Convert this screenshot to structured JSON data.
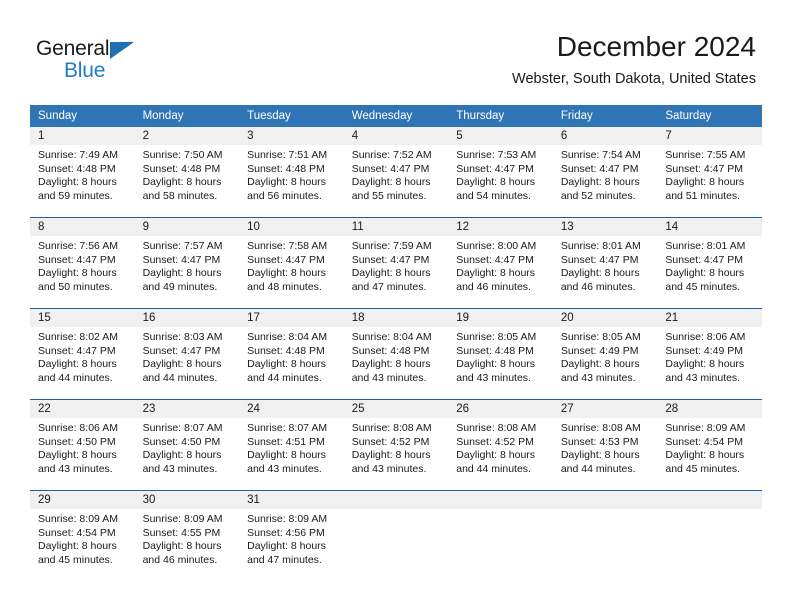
{
  "brand": {
    "name_part1": "General",
    "name_part2": "Blue",
    "accent_color": "#1f7ec4",
    "triangle_color": "#1f6fb5"
  },
  "header": {
    "title": "December 2024",
    "subtitle": "Webster, South Dakota, United States"
  },
  "calendar": {
    "header_bg": "#2f75b5",
    "daynum_bg": "#f0f0f0",
    "weekday_headers": [
      "Sunday",
      "Monday",
      "Tuesday",
      "Wednesday",
      "Thursday",
      "Friday",
      "Saturday"
    ],
    "weeks": [
      [
        {
          "day": "1",
          "sunrise": "Sunrise: 7:49 AM",
          "sunset": "Sunset: 4:48 PM",
          "daylight_line1": "Daylight: 8 hours",
          "daylight_line2": "and 59 minutes."
        },
        {
          "day": "2",
          "sunrise": "Sunrise: 7:50 AM",
          "sunset": "Sunset: 4:48 PM",
          "daylight_line1": "Daylight: 8 hours",
          "daylight_line2": "and 58 minutes."
        },
        {
          "day": "3",
          "sunrise": "Sunrise: 7:51 AM",
          "sunset": "Sunset: 4:48 PM",
          "daylight_line1": "Daylight: 8 hours",
          "daylight_line2": "and 56 minutes."
        },
        {
          "day": "4",
          "sunrise": "Sunrise: 7:52 AM",
          "sunset": "Sunset: 4:47 PM",
          "daylight_line1": "Daylight: 8 hours",
          "daylight_line2": "and 55 minutes."
        },
        {
          "day": "5",
          "sunrise": "Sunrise: 7:53 AM",
          "sunset": "Sunset: 4:47 PM",
          "daylight_line1": "Daylight: 8 hours",
          "daylight_line2": "and 54 minutes."
        },
        {
          "day": "6",
          "sunrise": "Sunrise: 7:54 AM",
          "sunset": "Sunset: 4:47 PM",
          "daylight_line1": "Daylight: 8 hours",
          "daylight_line2": "and 52 minutes."
        },
        {
          "day": "7",
          "sunrise": "Sunrise: 7:55 AM",
          "sunset": "Sunset: 4:47 PM",
          "daylight_line1": "Daylight: 8 hours",
          "daylight_line2": "and 51 minutes."
        }
      ],
      [
        {
          "day": "8",
          "sunrise": "Sunrise: 7:56 AM",
          "sunset": "Sunset: 4:47 PM",
          "daylight_line1": "Daylight: 8 hours",
          "daylight_line2": "and 50 minutes."
        },
        {
          "day": "9",
          "sunrise": "Sunrise: 7:57 AM",
          "sunset": "Sunset: 4:47 PM",
          "daylight_line1": "Daylight: 8 hours",
          "daylight_line2": "and 49 minutes."
        },
        {
          "day": "10",
          "sunrise": "Sunrise: 7:58 AM",
          "sunset": "Sunset: 4:47 PM",
          "daylight_line1": "Daylight: 8 hours",
          "daylight_line2": "and 48 minutes."
        },
        {
          "day": "11",
          "sunrise": "Sunrise: 7:59 AM",
          "sunset": "Sunset: 4:47 PM",
          "daylight_line1": "Daylight: 8 hours",
          "daylight_line2": "and 47 minutes."
        },
        {
          "day": "12",
          "sunrise": "Sunrise: 8:00 AM",
          "sunset": "Sunset: 4:47 PM",
          "daylight_line1": "Daylight: 8 hours",
          "daylight_line2": "and 46 minutes."
        },
        {
          "day": "13",
          "sunrise": "Sunrise: 8:01 AM",
          "sunset": "Sunset: 4:47 PM",
          "daylight_line1": "Daylight: 8 hours",
          "daylight_line2": "and 46 minutes."
        },
        {
          "day": "14",
          "sunrise": "Sunrise: 8:01 AM",
          "sunset": "Sunset: 4:47 PM",
          "daylight_line1": "Daylight: 8 hours",
          "daylight_line2": "and 45 minutes."
        }
      ],
      [
        {
          "day": "15",
          "sunrise": "Sunrise: 8:02 AM",
          "sunset": "Sunset: 4:47 PM",
          "daylight_line1": "Daylight: 8 hours",
          "daylight_line2": "and 44 minutes."
        },
        {
          "day": "16",
          "sunrise": "Sunrise: 8:03 AM",
          "sunset": "Sunset: 4:47 PM",
          "daylight_line1": "Daylight: 8 hours",
          "daylight_line2": "and 44 minutes."
        },
        {
          "day": "17",
          "sunrise": "Sunrise: 8:04 AM",
          "sunset": "Sunset: 4:48 PM",
          "daylight_line1": "Daylight: 8 hours",
          "daylight_line2": "and 44 minutes."
        },
        {
          "day": "18",
          "sunrise": "Sunrise: 8:04 AM",
          "sunset": "Sunset: 4:48 PM",
          "daylight_line1": "Daylight: 8 hours",
          "daylight_line2": "and 43 minutes."
        },
        {
          "day": "19",
          "sunrise": "Sunrise: 8:05 AM",
          "sunset": "Sunset: 4:48 PM",
          "daylight_line1": "Daylight: 8 hours",
          "daylight_line2": "and 43 minutes."
        },
        {
          "day": "20",
          "sunrise": "Sunrise: 8:05 AM",
          "sunset": "Sunset: 4:49 PM",
          "daylight_line1": "Daylight: 8 hours",
          "daylight_line2": "and 43 minutes."
        },
        {
          "day": "21",
          "sunrise": "Sunrise: 8:06 AM",
          "sunset": "Sunset: 4:49 PM",
          "daylight_line1": "Daylight: 8 hours",
          "daylight_line2": "and 43 minutes."
        }
      ],
      [
        {
          "day": "22",
          "sunrise": "Sunrise: 8:06 AM",
          "sunset": "Sunset: 4:50 PM",
          "daylight_line1": "Daylight: 8 hours",
          "daylight_line2": "and 43 minutes."
        },
        {
          "day": "23",
          "sunrise": "Sunrise: 8:07 AM",
          "sunset": "Sunset: 4:50 PM",
          "daylight_line1": "Daylight: 8 hours",
          "daylight_line2": "and 43 minutes."
        },
        {
          "day": "24",
          "sunrise": "Sunrise: 8:07 AM",
          "sunset": "Sunset: 4:51 PM",
          "daylight_line1": "Daylight: 8 hours",
          "daylight_line2": "and 43 minutes."
        },
        {
          "day": "25",
          "sunrise": "Sunrise: 8:08 AM",
          "sunset": "Sunset: 4:52 PM",
          "daylight_line1": "Daylight: 8 hours",
          "daylight_line2": "and 43 minutes."
        },
        {
          "day": "26",
          "sunrise": "Sunrise: 8:08 AM",
          "sunset": "Sunset: 4:52 PM",
          "daylight_line1": "Daylight: 8 hours",
          "daylight_line2": "and 44 minutes."
        },
        {
          "day": "27",
          "sunrise": "Sunrise: 8:08 AM",
          "sunset": "Sunset: 4:53 PM",
          "daylight_line1": "Daylight: 8 hours",
          "daylight_line2": "and 44 minutes."
        },
        {
          "day": "28",
          "sunrise": "Sunrise: 8:09 AM",
          "sunset": "Sunset: 4:54 PM",
          "daylight_line1": "Daylight: 8 hours",
          "daylight_line2": "and 45 minutes."
        }
      ],
      [
        {
          "day": "29",
          "sunrise": "Sunrise: 8:09 AM",
          "sunset": "Sunset: 4:54 PM",
          "daylight_line1": "Daylight: 8 hours",
          "daylight_line2": "and 45 minutes."
        },
        {
          "day": "30",
          "sunrise": "Sunrise: 8:09 AM",
          "sunset": "Sunset: 4:55 PM",
          "daylight_line1": "Daylight: 8 hours",
          "daylight_line2": "and 46 minutes."
        },
        {
          "day": "31",
          "sunrise": "Sunrise: 8:09 AM",
          "sunset": "Sunset: 4:56 PM",
          "daylight_line1": "Daylight: 8 hours",
          "daylight_line2": "and 47 minutes."
        },
        {
          "day": "",
          "sunrise": "",
          "sunset": "",
          "daylight_line1": "",
          "daylight_line2": ""
        },
        {
          "day": "",
          "sunrise": "",
          "sunset": "",
          "daylight_line1": "",
          "daylight_line2": ""
        },
        {
          "day": "",
          "sunrise": "",
          "sunset": "",
          "daylight_line1": "",
          "daylight_line2": ""
        },
        {
          "day": "",
          "sunrise": "",
          "sunset": "",
          "daylight_line1": "",
          "daylight_line2": ""
        }
      ]
    ]
  }
}
